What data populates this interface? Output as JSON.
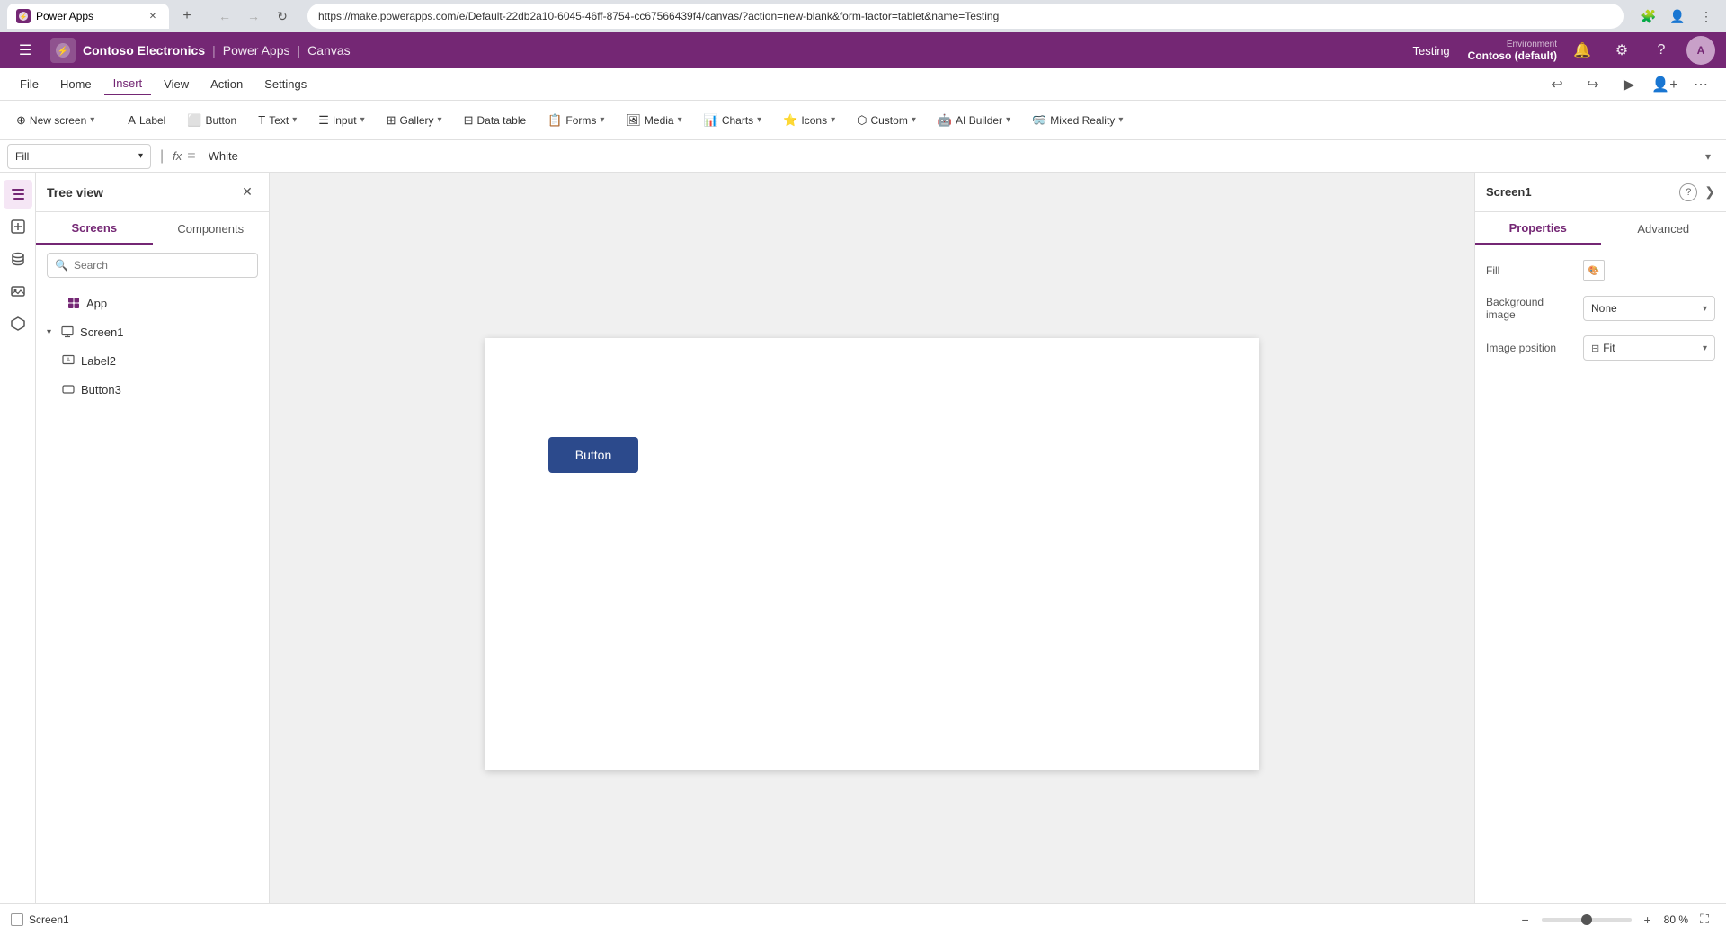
{
  "browser": {
    "tab_label": "Power Apps",
    "url": "https://make.powerapps.com/e/Default-22db2a10-6045-46ff-8754-cc67566439f4/canvas/?action=new-blank&form-factor=tablet&name=Testing",
    "new_tab_label": "+"
  },
  "app_header": {
    "logo_text": "⚡",
    "brand_name": "Contoso Electronics",
    "app_name": "Power Apps",
    "canvas_label": "Canvas",
    "environment_label": "Environment",
    "environment_name": "Contoso (default)",
    "app_title": "Testing"
  },
  "menu": {
    "items": [
      "File",
      "Home",
      "Insert",
      "View",
      "Action",
      "Settings"
    ]
  },
  "toolbar": {
    "new_screen_label": "New screen",
    "label_label": "Label",
    "button_label": "Button",
    "text_label": "Text",
    "input_label": "Input",
    "gallery_label": "Gallery",
    "data_table_label": "Data table",
    "forms_label": "Forms",
    "media_label": "Media",
    "charts_label": "Charts",
    "icons_label": "Icons",
    "custom_label": "Custom",
    "ai_builder_label": "AI Builder",
    "mixed_reality_label": "Mixed Reality"
  },
  "formula_bar": {
    "property": "Fill",
    "formula": "White"
  },
  "tree_view": {
    "title": "Tree view",
    "tabs": [
      "Screens",
      "Components"
    ],
    "search_placeholder": "Search",
    "items": [
      {
        "id": "app",
        "label": "App",
        "indent": 0,
        "type": "app",
        "expanded": false
      },
      {
        "id": "screen1",
        "label": "Screen1",
        "indent": 0,
        "type": "screen",
        "expanded": true
      },
      {
        "id": "label2",
        "label": "Label2",
        "indent": 1,
        "type": "label"
      },
      {
        "id": "button3",
        "label": "Button3",
        "indent": 1,
        "type": "button"
      }
    ]
  },
  "canvas": {
    "button_label": "Button",
    "screen_label": "Screen1"
  },
  "right_panel": {
    "title": "Screen1",
    "tabs": [
      "Properties",
      "Advanced"
    ],
    "fill_label": "Fill",
    "fill_value": "",
    "fill_color": "white",
    "background_image_label": "Background image",
    "background_image_value": "None",
    "image_position_label": "Image position",
    "image_position_value": "Fit"
  },
  "bottom_bar": {
    "screen_label": "Screen1",
    "zoom_level": "80 %"
  },
  "icons": {
    "hamburger": "☰",
    "search": "🔍",
    "layers": "⊞",
    "data": "⊟",
    "gear": "⚙",
    "variables": "∑",
    "components": "⬡",
    "chevron_down": "▾",
    "chevron_right": "▸",
    "close": "✕",
    "help": "?",
    "expand": "❯",
    "undo": "↩",
    "redo": "↪",
    "play": "▶",
    "person_plus": "👤",
    "notification": "🔔",
    "settings": "⚙",
    "apps_grid": "⊞",
    "plus": "+",
    "minus": "−",
    "fullscreen": "⛶",
    "three_dots": "···",
    "collapse_left": "❮"
  }
}
